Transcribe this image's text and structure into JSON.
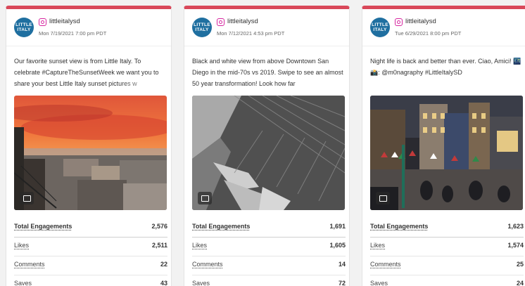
{
  "avatar_text": [
    "LITTLE",
    "ITALY"
  ],
  "posts": [
    {
      "handle": "littleitalysd",
      "date": "Mon 7/19/2021 7:00 pm PDT",
      "caption": "Our favorite sunset view is from Little Italy. To celebrate #CaptureTheSunsetWeek we want you to share your best Little Italy sunset pictures w",
      "stats": [
        {
          "label": "Total Engagements",
          "value": "2,576"
        },
        {
          "label": "Likes",
          "value": "2,511"
        },
        {
          "label": "Comments",
          "value": "22"
        },
        {
          "label": "Saves",
          "value": "43"
        }
      ]
    },
    {
      "handle": "littleitalysd",
      "date": "Mon 7/12/2021 4:53 pm PDT",
      "caption": "Black and white view from above Downtown San Diego in the mid-70s vs 2019. Swipe to see an almost 50 year transformation! Look how far",
      "stats": [
        {
          "label": "Total Engagements",
          "value": "1,691"
        },
        {
          "label": "Likes",
          "value": "1,605"
        },
        {
          "label": "Comments",
          "value": "14"
        },
        {
          "label": "Saves",
          "value": "72"
        }
      ]
    },
    {
      "handle": "littleitalysd",
      "date": "Tue 6/29/2021 8:00 pm PDT",
      "caption": "Night life is back and better than ever. Ciao, Amici! 🌃 📸: @m0nagraphy #LittleItalySD",
      "stats": [
        {
          "label": "Total Engagements",
          "value": "1,623"
        },
        {
          "label": "Likes",
          "value": "1,574"
        },
        {
          "label": "Comments",
          "value": "25"
        },
        {
          "label": "Saves",
          "value": "24"
        }
      ]
    }
  ],
  "colors": {
    "accent_bar": "#d9485a",
    "avatar_bg": "#1f6fa0",
    "instagram": "#d6249f"
  },
  "icons": {
    "platform": "instagram-icon",
    "media": "image-icon"
  }
}
